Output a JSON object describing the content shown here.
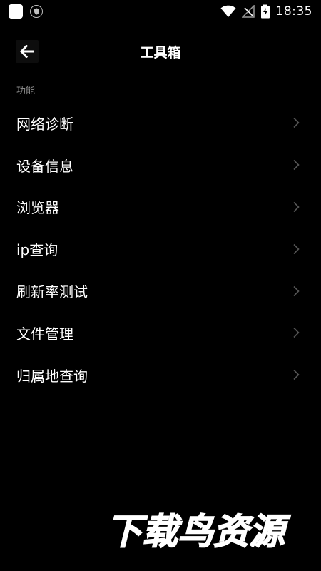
{
  "status_bar": {
    "time": "18:35",
    "icons": [
      "app-icon",
      "shield-icon",
      "wifi-icon",
      "no-signal-icon",
      "battery-charging-icon"
    ]
  },
  "header": {
    "title": "工具箱",
    "back_icon": "arrow-left-icon"
  },
  "section": {
    "label": "功能"
  },
  "menu": {
    "items": [
      {
        "label": "网络诊断"
      },
      {
        "label": "设备信息"
      },
      {
        "label": "浏览器"
      },
      {
        "label": "ip查询"
      },
      {
        "label": "刷新率测试"
      },
      {
        "label": "文件管理"
      },
      {
        "label": "归属地查询"
      }
    ],
    "chevron_icon": "chevron-right-icon"
  },
  "watermark": {
    "text": "下载鸟资源"
  },
  "colors": {
    "background": "#000000",
    "text": "#ffffff",
    "secondary_text": "#8a8a8a",
    "chevron": "#555555"
  }
}
